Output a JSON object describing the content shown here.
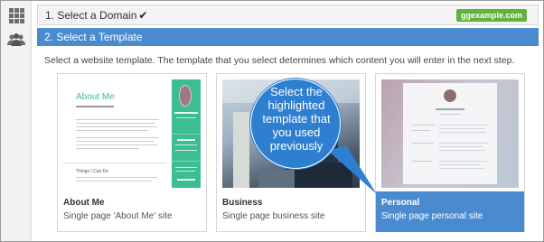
{
  "steps": {
    "domain": {
      "title": "1. Select a Domain",
      "check_icon": "check-icon",
      "badge": "ggexample.com"
    },
    "template": {
      "title": "2. Select a Template"
    }
  },
  "description": "Select a website template. The template that you select determines which content you will enter in the next step.",
  "templates": [
    {
      "name": "About Me",
      "subtitle": "Single page 'About Me' site",
      "selected": false
    },
    {
      "name": "Business",
      "subtitle": "Single page business site",
      "selected": false
    },
    {
      "name": "Personal",
      "subtitle": "Single page personal site",
      "selected": true
    }
  ],
  "callout": {
    "line1": "Select the",
    "line2": "highlighted",
    "line3": "template that",
    "line4": "you used",
    "line5": "previously"
  },
  "preview_about": {
    "heading": "About Me",
    "things": "Things I Can Do"
  },
  "colors": {
    "accent": "#4a8bd0",
    "badge": "#62b33d",
    "callout": "#2f7fd1"
  },
  "icons": {
    "left_nav": [
      "apps-grid-icon",
      "people-icon"
    ]
  }
}
